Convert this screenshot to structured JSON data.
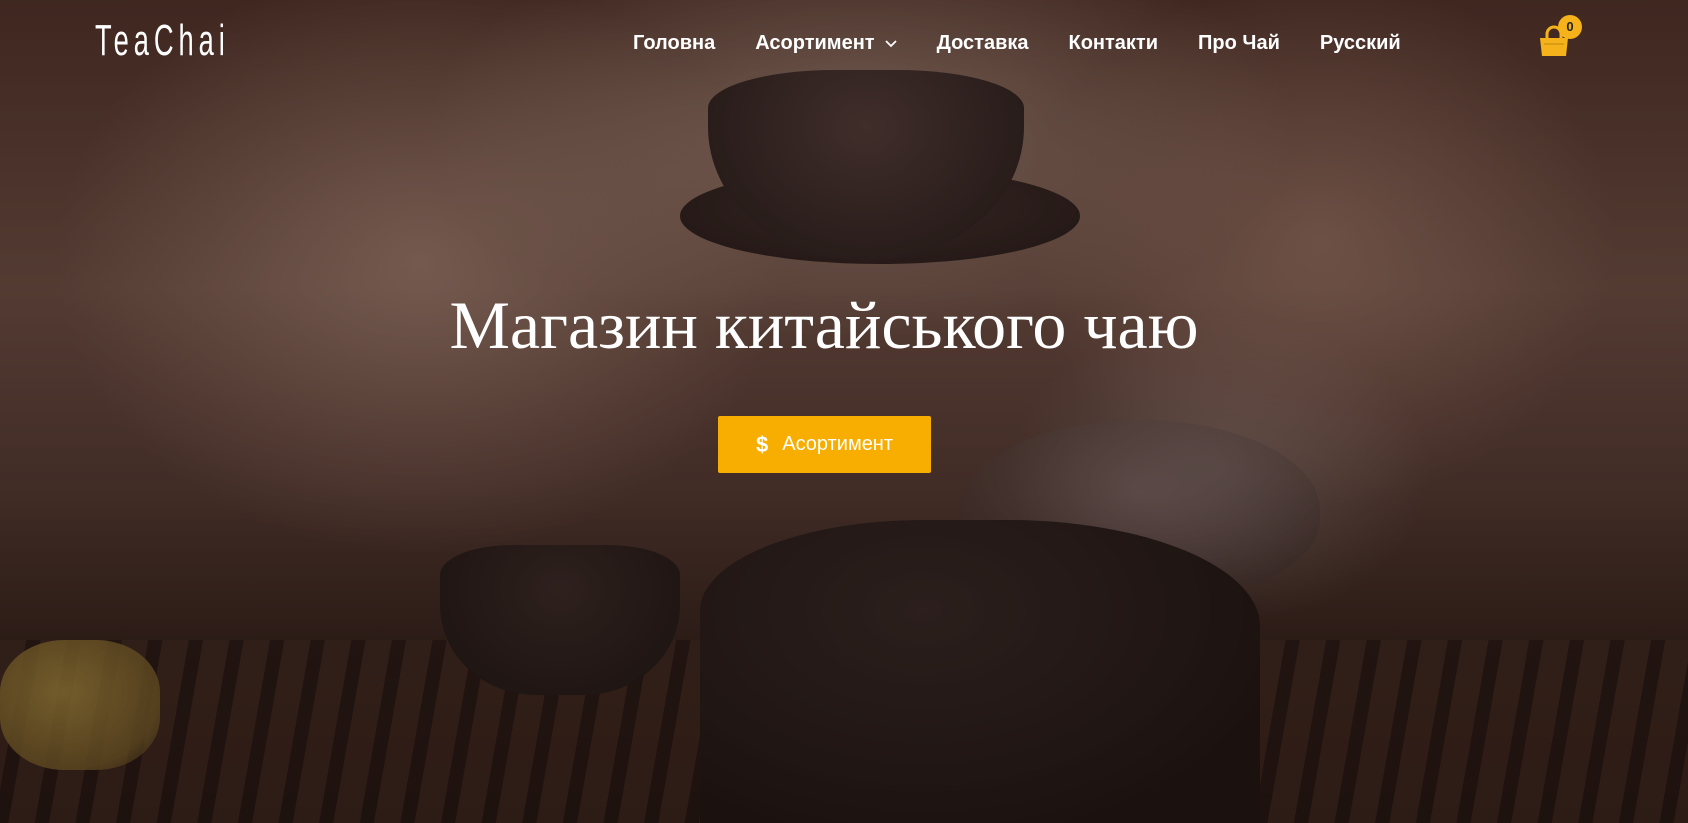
{
  "brand": {
    "logo_text": "TeaChai"
  },
  "nav": {
    "items": [
      {
        "label": "Головна"
      },
      {
        "label": "Асортимент",
        "has_dropdown": true
      },
      {
        "label": "Доставка"
      },
      {
        "label": "Контакти"
      },
      {
        "label": "Про Чай"
      },
      {
        "label": "Русский"
      }
    ]
  },
  "cart": {
    "count": "0",
    "icon": "shopping-bag-icon"
  },
  "hero": {
    "title": "Магазин китайського чаю",
    "button_label": "Асортимент",
    "button_icon": "$",
    "background": "tea-ceremony-photo"
  },
  "colors": {
    "accent": "#f8ae00",
    "badge": "#f5b21b",
    "text": "#ffffff"
  }
}
